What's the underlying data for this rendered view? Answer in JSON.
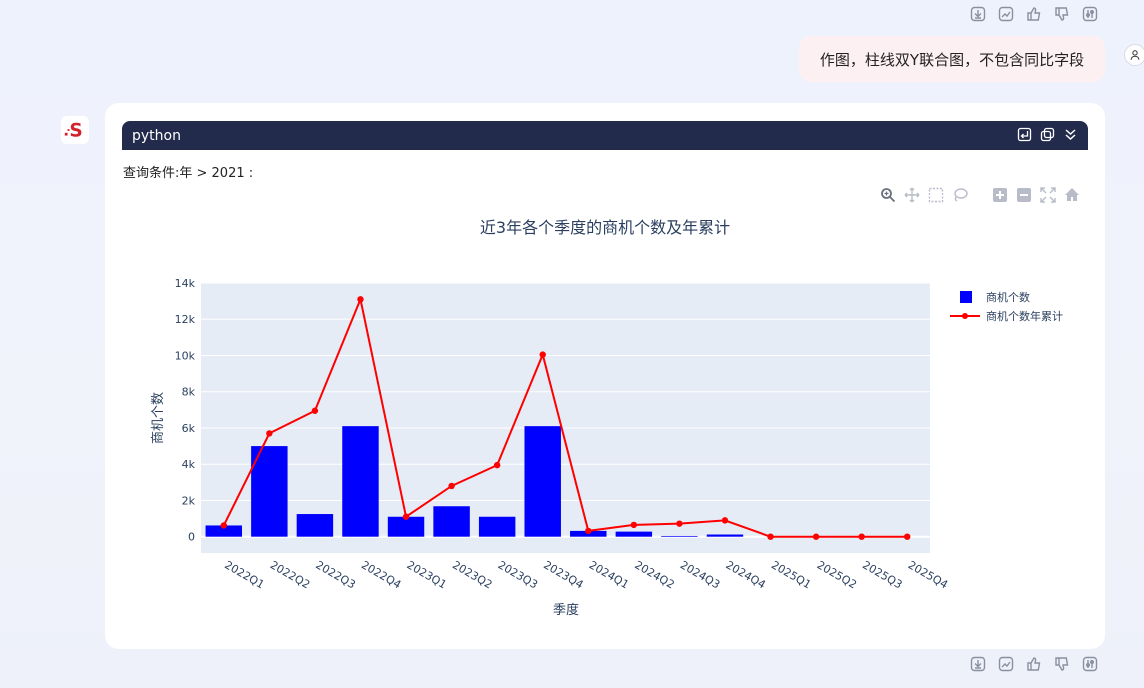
{
  "header_actions": [
    "download-icon",
    "chart-icon",
    "thumbs-up-icon",
    "thumbs-down-icon",
    "settings-icon"
  ],
  "user_message": "作图，柱线双Y联合图，不包含同比字段",
  "code_block": {
    "language": "python"
  },
  "query_condition": "查询条件:年 > 2021 :",
  "colors": {
    "bar": "#0000ff",
    "line": "#ff0000",
    "plot_bg": "#e5ecf6",
    "code_header_bg": "#232b4d"
  },
  "chart_data": {
    "type": "bar",
    "title": "近3年各个季度的商机个数及年累计",
    "xlabel": "季度",
    "ylabel": "商机个数",
    "categories": [
      "2022Q1",
      "2022Q2",
      "2022Q3",
      "2022Q4",
      "2023Q1",
      "2023Q2",
      "2023Q3",
      "2023Q4",
      "2024Q1",
      "2024Q2",
      "2024Q3",
      "2024Q4",
      "2025Q1",
      "2025Q2",
      "2025Q3",
      "2025Q4"
    ],
    "ylim": [
      -900,
      14000
    ],
    "yticks": [
      0,
      2000,
      4000,
      6000,
      8000,
      10000,
      12000,
      14000
    ],
    "ytick_labels": [
      "0",
      "2k",
      "4k",
      "6k",
      "8k",
      "10k",
      "12k",
      "14k"
    ],
    "grid": true,
    "legend_position": "top-right",
    "series": [
      {
        "name": "商机个数",
        "type": "bar",
        "values": [
          620,
          5000,
          1250,
          6100,
          1100,
          1680,
          1100,
          6100,
          320,
          280,
          40,
          120,
          0,
          0,
          0,
          0
        ]
      },
      {
        "name": "商机个数年累计",
        "type": "line",
        "values": [
          620,
          5700,
          6950,
          13100,
          1100,
          2800,
          3950,
          10050,
          320,
          650,
          720,
          900,
          0,
          0,
          0,
          0
        ]
      }
    ]
  }
}
